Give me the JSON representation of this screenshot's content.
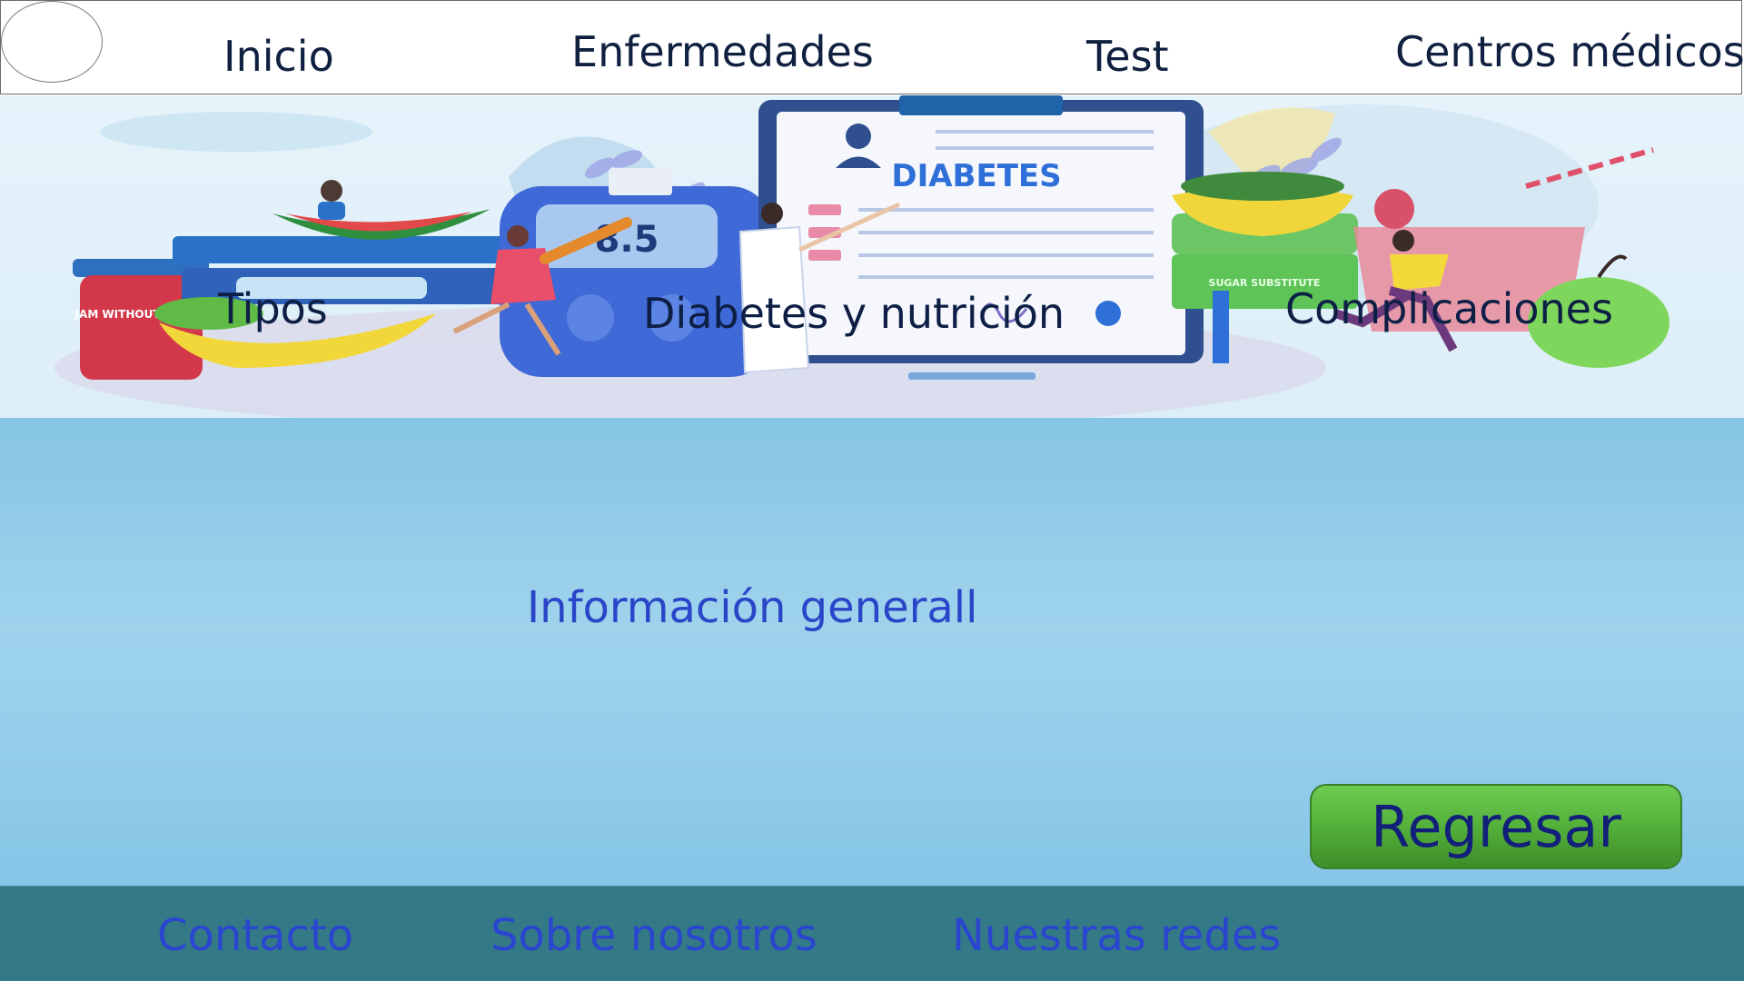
{
  "header": {
    "logo_icon": "logo-circle",
    "nav": [
      "Inicio",
      "Enfermedades",
      "Test",
      "Centros médicos"
    ]
  },
  "banner": {
    "illustration_text": "DIABETES",
    "meter_reading": "8.5",
    "jar_label": "JAM WITHOUT SUGAR",
    "box_label": "SUGAR SUBSTITUTE",
    "links": [
      "Tipos",
      "Diabetes y nutrición",
      "Complicaciones"
    ]
  },
  "main": {
    "title": "Información generall",
    "back_button": "Regresar"
  },
  "footer": {
    "links": [
      "Contacto",
      "Sobre nosotros",
      "Nuestras redes"
    ]
  },
  "colors": {
    "nav_text": "#102040",
    "banner_bg": "#e6f3fb",
    "main_bg": "#9fd3ec",
    "info_text": "#2a45c8",
    "button_green": "#56b33c",
    "button_text": "#12207a",
    "footer_bg": "#337a86",
    "footer_text": "#2a45d0"
  }
}
